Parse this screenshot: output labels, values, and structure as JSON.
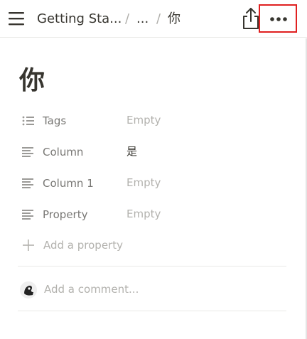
{
  "topbar": {
    "breadcrumb_title": "Getting Sta...",
    "separator": "/",
    "ellipsis": "...",
    "current_page": "你"
  },
  "icons": {
    "menu": "hamburger-menu-icon",
    "share": "share-icon",
    "more": "more-horizontal-icon",
    "add": "plus-icon"
  },
  "page": {
    "title": "你"
  },
  "properties": [
    {
      "name": "Tags",
      "value": "Empty",
      "icon": "list-icon",
      "filled": false
    },
    {
      "name": "Column",
      "value": "是",
      "icon": "text-lines-icon",
      "filled": true
    },
    {
      "name": "Column 1",
      "value": "Empty",
      "icon": "text-lines-icon",
      "filled": false
    },
    {
      "name": "Property",
      "value": "Empty",
      "icon": "text-lines-icon",
      "filled": false
    }
  ],
  "add_property_label": "Add a property",
  "comment": {
    "placeholder": "Add a comment..."
  },
  "colors": {
    "highlight_border": "#e02020",
    "text": "#37352f",
    "muted": "#787774",
    "placeholder": "#b3b2ae"
  }
}
